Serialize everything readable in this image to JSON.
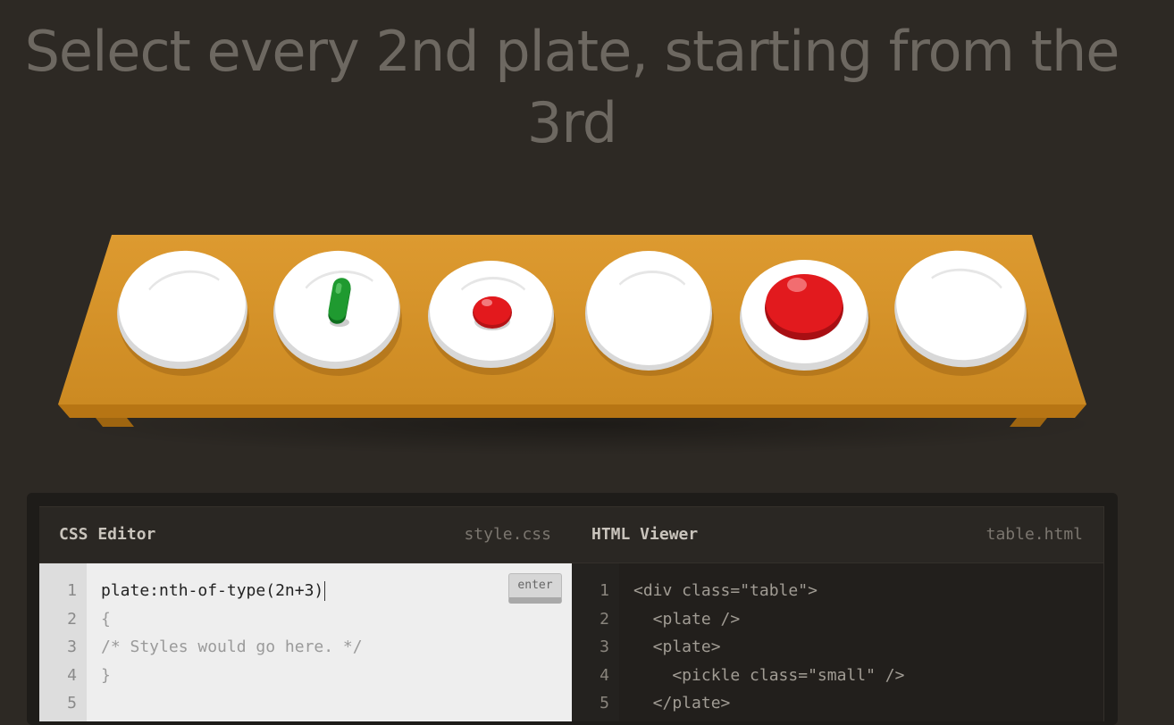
{
  "instruction": {
    "line1": "Select every 2nd plate, starting from the",
    "line2": "3rd"
  },
  "table": {
    "items": [
      {
        "type": "plate",
        "contents": "empty"
      },
      {
        "type": "plate",
        "contents": "pickle"
      },
      {
        "type": "plate",
        "contents": "small apple"
      },
      {
        "type": "plate",
        "contents": "empty"
      },
      {
        "type": "plate",
        "contents": "apple"
      },
      {
        "type": "plate",
        "contents": "empty"
      }
    ]
  },
  "css_editor": {
    "title": "CSS Editor",
    "filename": "style.css",
    "input_value": "plate:nth-of-type(2n+3)",
    "enter_label": "enter",
    "lines": [
      "1",
      "2",
      "3",
      "4",
      "5"
    ],
    "brace_open": "{",
    "comment": "/* Styles would go here. */",
    "brace_close": "}"
  },
  "html_viewer": {
    "title": "HTML Viewer",
    "filename": "table.html",
    "lines": [
      "1",
      "2",
      "3",
      "4",
      "5"
    ],
    "code": [
      "<div class=\"table\">",
      "  <plate />",
      "  <plate>",
      "    <pickle class=\"small\" />",
      "  </plate>"
    ]
  },
  "colors": {
    "background": "#2d2924",
    "table": "#d4901f",
    "apple_red": "#e0191c",
    "pickle_green": "#1f8f2e"
  }
}
